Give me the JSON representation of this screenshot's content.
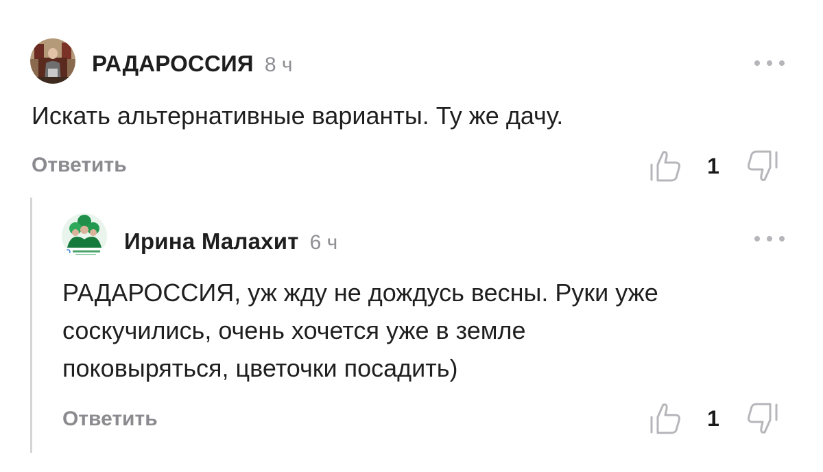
{
  "comments": [
    {
      "author": "РАДАРОССИЯ",
      "time": "8 ч",
      "avatar_icon": "photo-avatar-man-in-chair",
      "text": "Искать альтернативные варианты. Ту же дачу.",
      "reply_label": "Ответить",
      "likes": "1",
      "more_icon": "more-dots-icon"
    }
  ],
  "replies": [
    {
      "author": "Ирина Малахит",
      "time": "6 ч",
      "avatar_icon": "photo-avatar-green-figures-logo",
      "text_lines": [
        "РАДАРОССИЯ, уж жду не дождусь весны. Руки уже",
        "соскучились, очень хочется уже в земле",
        "поковыряться, цветочки посадить)"
      ],
      "reply_label": "Ответить",
      "likes": "1",
      "more_icon": "more-dots-icon"
    }
  ],
  "colors": {
    "text": "#1f1f1f",
    "muted": "#8e8e93",
    "icon": "#b5b5ba",
    "thread_line": "#d5d5d8"
  }
}
